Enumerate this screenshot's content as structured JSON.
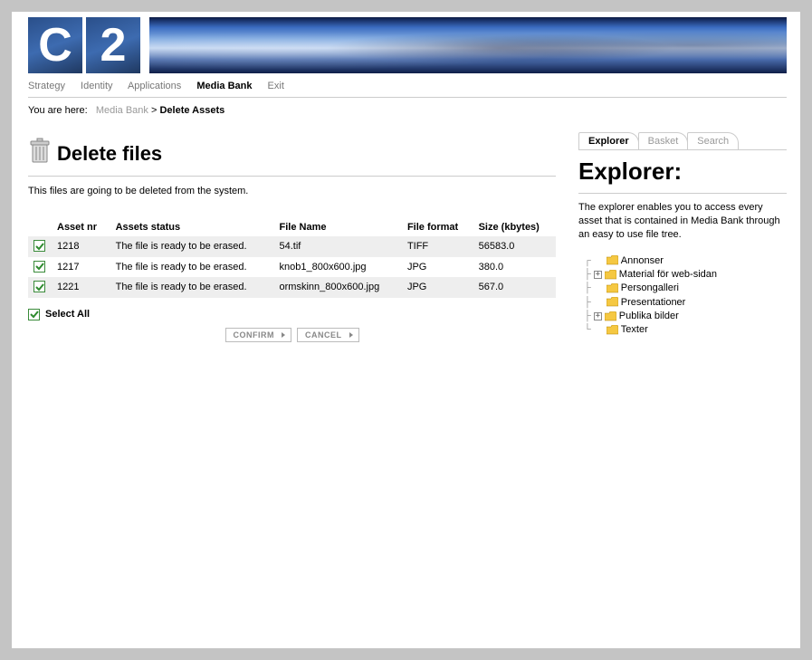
{
  "logo": {
    "tile1": "C",
    "tile2": "2"
  },
  "nav": {
    "strategy": "Strategy",
    "identity": "Identity",
    "applications": "Applications",
    "media_bank": "Media Bank",
    "exit": "Exit"
  },
  "breadcrumb": {
    "label": "You are here:",
    "media_bank": "Media Bank",
    "sep": ">",
    "current": "Delete Assets"
  },
  "main": {
    "title": "Delete files",
    "intro": "This files are going to be deleted from the system.",
    "columns": {
      "asset_nr": "Asset nr",
      "status": "Assets status",
      "file_name": "File Name",
      "format": "File format",
      "size": "Size (kbytes)"
    },
    "rows": [
      {
        "nr": "1218",
        "status": "The file is ready to be erased.",
        "name": "54.tif",
        "format": "TIFF",
        "size": "56583.0"
      },
      {
        "nr": "1217",
        "status": "The file is ready to be erased.",
        "name": "knob1_800x600.jpg",
        "format": "JPG",
        "size": "380.0"
      },
      {
        "nr": "1221",
        "status": "The file is ready to be erased.",
        "name": "ormskinn_800x600.jpg",
        "format": "JPG",
        "size": "567.0"
      }
    ],
    "select_all": "Select All",
    "confirm": "CONFIRM",
    "cancel": "CANCEL"
  },
  "sidebar": {
    "tabs": {
      "explorer": "Explorer",
      "basket": "Basket",
      "search": "Search"
    },
    "title": "Explorer:",
    "description": "The explorer enables you to access every asset that is contained in Media Bank through an easy to use file tree.",
    "tree": {
      "annonser": "Annonser",
      "material": "Material för web-sidan",
      "persongalleri": "Persongalleri",
      "presentationer": "Presentationer",
      "publika": "Publika bilder",
      "texter": "Texter",
      "plus": "+"
    }
  }
}
